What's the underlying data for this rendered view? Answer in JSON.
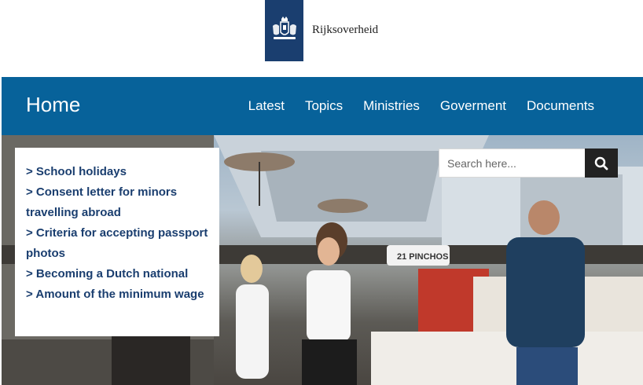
{
  "header": {
    "logo_text": "Rijksoverheid",
    "logo_icon": "crest-icon",
    "logo_color": "#1a3e6f"
  },
  "nav": {
    "home": "Home",
    "links": [
      "Latest",
      "Topics",
      "Ministries",
      "Goverment",
      "Documents"
    ],
    "background": "#07629a"
  },
  "quick_links": {
    "items": [
      "> School holidays",
      "> Consent letter for minors travelling abroad",
      "> Criteria for accepting passport photos",
      "> Becoming a Dutch national",
      "> Amount of the minimum wage"
    ],
    "color": "#1a3e6f"
  },
  "search": {
    "placeholder": "Search here...",
    "button_icon": "search-icon"
  },
  "hero": {
    "sign_text": "21 PINCHOS"
  }
}
